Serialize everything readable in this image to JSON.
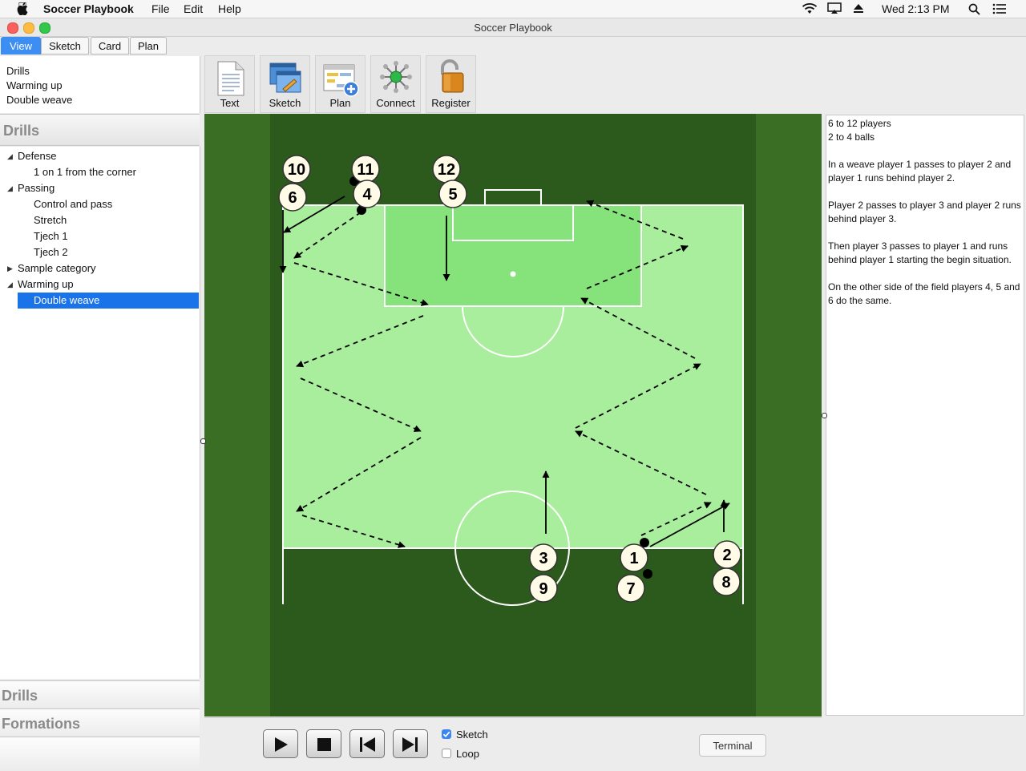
{
  "menubar": {
    "app_name": "Soccer Playbook",
    "menus": [
      "File",
      "Edit",
      "Help"
    ],
    "clock": "Wed 2:13 PM"
  },
  "window": {
    "title": "Soccer Playbook"
  },
  "tabs": [
    "View",
    "Sketch",
    "Card",
    "Plan"
  ],
  "breadcrumb": [
    "Drills",
    "Warming up",
    "Double weave"
  ],
  "toolbar": [
    "Text",
    "Sketch",
    "Plan",
    "Connect",
    "Register"
  ],
  "sidebar": {
    "header": "Drills",
    "tree": [
      {
        "label": "Defense",
        "level": 0,
        "expanded": true
      },
      {
        "label": "1 on 1 from the corner",
        "level": 1
      },
      {
        "label": "Passing",
        "level": 0,
        "expanded": true
      },
      {
        "label": "Control and pass",
        "level": 1
      },
      {
        "label": "Stretch",
        "level": 1
      },
      {
        "label": "Tjech 1",
        "level": 1
      },
      {
        "label": "Tjech 2",
        "level": 1
      },
      {
        "label": "Sample category",
        "level": 0,
        "expanded": false
      },
      {
        "label": "Warming up",
        "level": 0,
        "expanded": true
      },
      {
        "label": "Double weave",
        "level": 1,
        "selected": true
      }
    ],
    "bottom_sections": [
      "Drills",
      "Formations"
    ]
  },
  "players": [
    "10",
    "11",
    "12",
    "6",
    "4",
    "5",
    "3",
    "1",
    "2",
    "9",
    "7",
    "8"
  ],
  "notes": [
    "6 to 12 players\n2 to 4 balls",
    "In a weave player 1 passes to player 2 and player 1 runs behind player 2.",
    "Player 2 passes to player 3 and player 2 runs behind player 3.",
    "Then player 3 passes to player 1 and runs behind player 1 starting the begin situation.",
    "On the other side of the field players 4, 5 and 6 do the same."
  ],
  "controls": {
    "sketch_label": "Sketch",
    "sketch_checked": true,
    "loop_label": "Loop",
    "loop_checked": false,
    "terminal_label": "Terminal"
  },
  "colors": {
    "accent": "#3d8ef2",
    "selection": "#1a73e8",
    "pitch_dark": "#2d5a1e",
    "pitch_light": "#a9ee9d",
    "penalty_area": "#86e27a"
  }
}
